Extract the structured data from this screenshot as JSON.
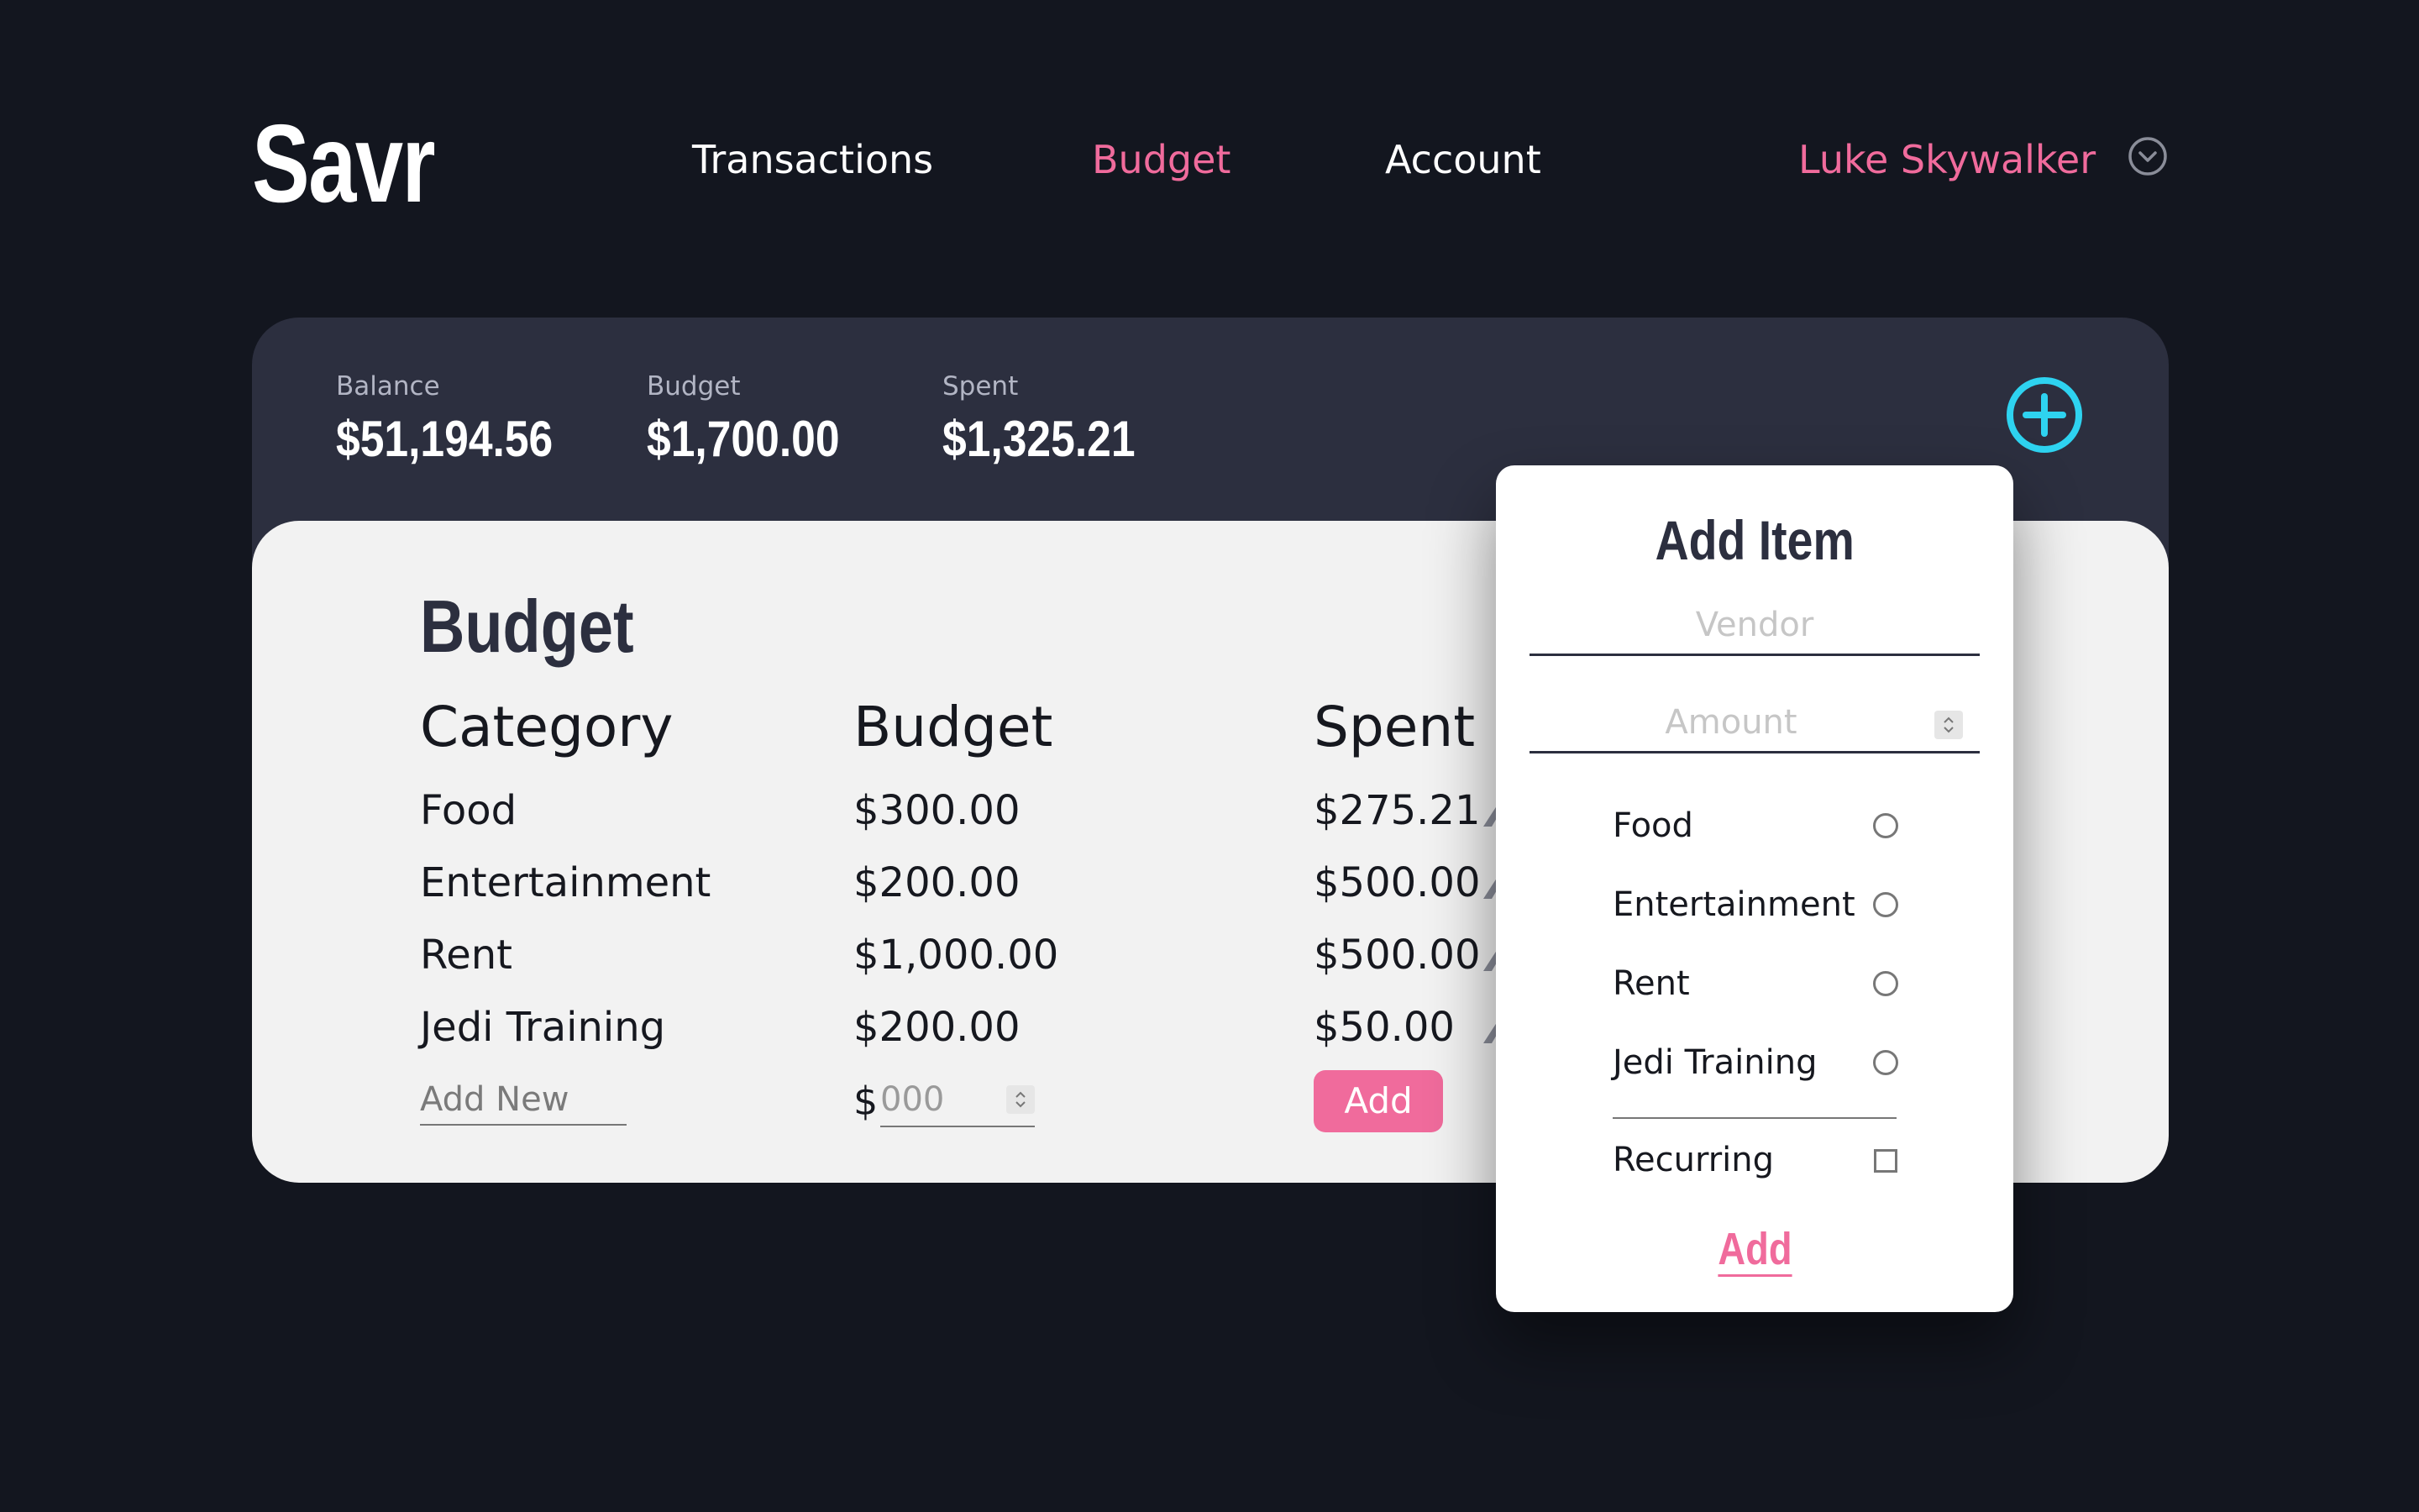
{
  "app": {
    "logo": "Savr"
  },
  "nav": {
    "items": [
      {
        "label": "Transactions",
        "active": false
      },
      {
        "label": "Budget",
        "active": true
      },
      {
        "label": "Account",
        "active": false
      }
    ],
    "user_name": "Luke Skywalker"
  },
  "summary": {
    "stats": [
      {
        "label": "Balance",
        "value": "$51,194.56"
      },
      {
        "label": "Budget",
        "value": "$1,700.00"
      },
      {
        "label": "Spent",
        "value": "$1,325.21"
      }
    ]
  },
  "budget": {
    "title": "Budget",
    "columns": [
      "Category",
      "Budget",
      "Spent"
    ],
    "rows": [
      {
        "category": "Food",
        "budget": "$300.00",
        "spent": "$275.21"
      },
      {
        "category": "Entertainment",
        "budget": "$200.00",
        "spent": "$500.00"
      },
      {
        "category": "Rent",
        "budget": "$1,000.00",
        "spent": "$500.00"
      },
      {
        "category": "Jedi Training",
        "budget": "$200.00",
        "spent": "$50.00"
      }
    ],
    "add_new_placeholder": "Add New",
    "currency_symbol": "$",
    "amount_placeholder": "000",
    "add_label": "Add"
  },
  "add_item": {
    "title": "Add Item",
    "vendor_placeholder": "Vendor",
    "amount_placeholder": "Amount",
    "categories": [
      "Food",
      "Entertainment",
      "Rent",
      "Jedi Training"
    ],
    "recurring_label": "Recurring",
    "add_label": "Add"
  },
  "colors": {
    "background": "#13161f",
    "panel": "#2c2f3f",
    "card": "#f2f2f2",
    "accent_pink": "#f06b9c",
    "accent_cyan": "#2ed3f0"
  },
  "icons": {
    "user_menu": "chevron-down-circle-icon",
    "add": "plus-circle-icon",
    "row_action": "edit-icon"
  }
}
